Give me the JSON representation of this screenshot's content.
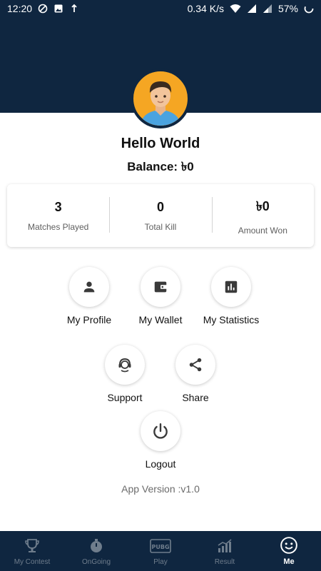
{
  "status_bar": {
    "time": "12:20",
    "network_speed": "0.34 K/s",
    "battery": "57%"
  },
  "profile": {
    "name": "Hello World",
    "balance": "Balance: ৳0"
  },
  "stats": [
    {
      "value": "3",
      "label": "Matches Played"
    },
    {
      "value": "0",
      "label": "Total Kill"
    },
    {
      "value": "৳0",
      "label": "Amount Won"
    }
  ],
  "actions": {
    "my_profile": "My Profile",
    "my_wallet": "My Wallet",
    "my_statistics": "My Statistics",
    "support": "Support",
    "share": "Share",
    "logout": "Logout"
  },
  "app_version": "App Version :v1.0",
  "bottom_nav": [
    {
      "label": "My Contest",
      "icon": "trophy-icon",
      "active": false
    },
    {
      "label": "OnGoing",
      "icon": "stopwatch-icon",
      "active": false
    },
    {
      "label": "Play",
      "icon": "pubg-icon",
      "active": false
    },
    {
      "label": "Result",
      "icon": "chart-icon",
      "active": false
    },
    {
      "label": "Me",
      "icon": "smiley-icon",
      "active": true
    }
  ],
  "colors": {
    "header": "#0f2640",
    "avatar_bg": "#f5a623",
    "nav_inactive": "#6f7d8c",
    "nav_active": "#ffffff"
  }
}
